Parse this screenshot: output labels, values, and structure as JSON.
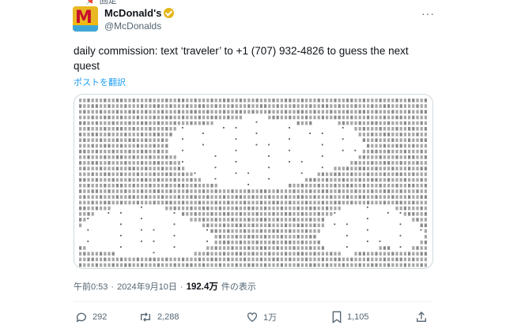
{
  "pinned": {
    "label": "固定"
  },
  "author": {
    "name": "McDonald's",
    "handle": "@McDonalds"
  },
  "tweet": {
    "text": "daily commission: text ‘traveler’ to +1 (707) 932-4826 to guess the next quest",
    "translate_label": "ポストを翻訳"
  },
  "meta": {
    "time": "午前0:53",
    "sep": "·",
    "date": "2024年9月10日",
    "sep2": "·",
    "views": "192.4万",
    "views_label": "件の表示"
  },
  "actions": {
    "replies": "292",
    "reposts": "2,288",
    "likes": "1万",
    "bookmarks": "1,105"
  },
  "icons": [
    "pin-icon",
    "verified-badge-icon",
    "more-icon",
    "reply-icon",
    "repost-icon",
    "like-icon",
    "bookmark-icon",
    "share-icon"
  ],
  "colors": {
    "link": "#1d9bf0",
    "muted": "#536471",
    "text": "#0f1419",
    "badge": "#e2b719"
  }
}
